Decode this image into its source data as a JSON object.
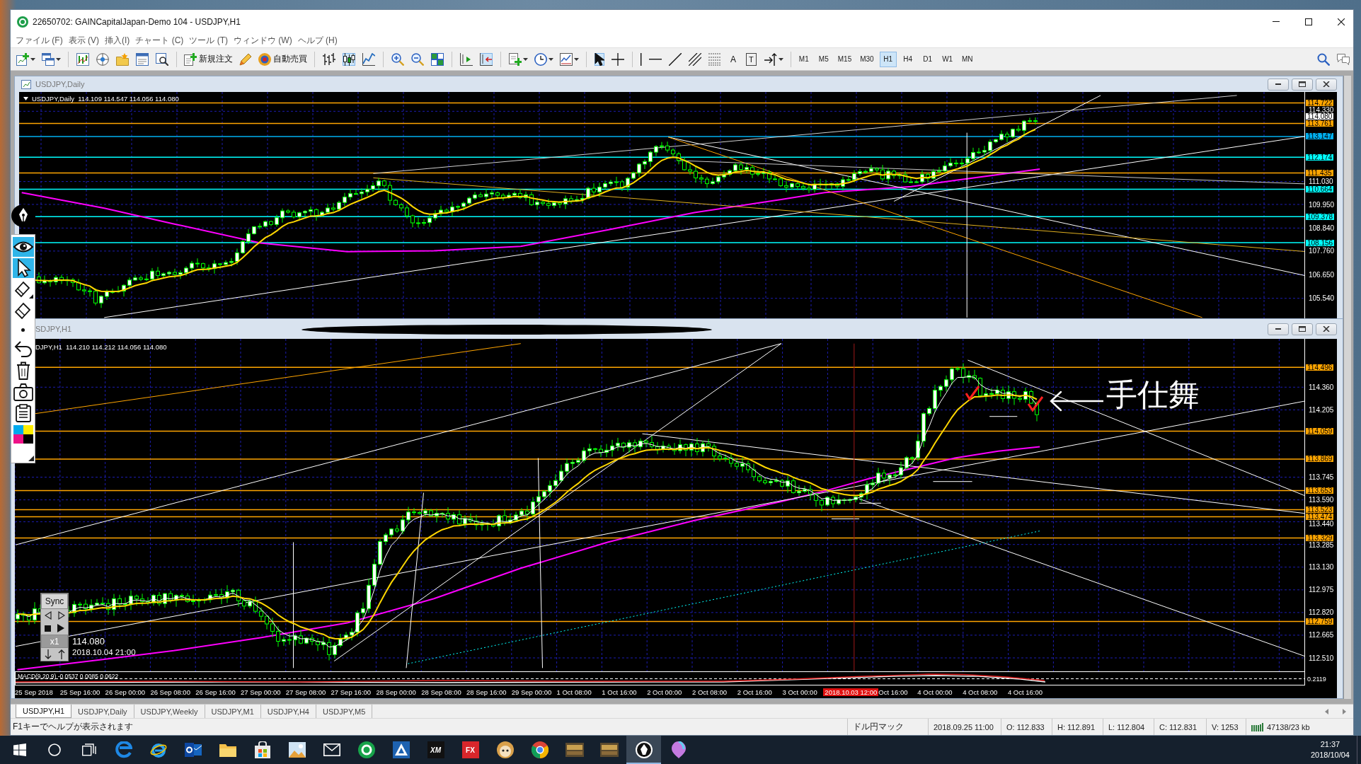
{
  "window": {
    "title": "22650702: GAINCapitalJapan-Demo 104 - USDJPY,H1"
  },
  "menu": [
    {
      "label": "ファイル (F)"
    },
    {
      "label": "表示 (V)"
    },
    {
      "label": "挿入(I)"
    },
    {
      "label": "チャート (C)"
    },
    {
      "label": "ツール (T)"
    },
    {
      "label": "ウィンドウ (W)"
    },
    {
      "label": "ヘルプ (H)"
    }
  ],
  "toolbar": {
    "order_buttons": [
      {
        "kind": "new_order",
        "label": "新規注文"
      },
      {
        "kind": "expert",
        "label": "自動売買"
      }
    ],
    "chart_types": [
      {
        "kind": "bars",
        "selected": false
      },
      {
        "kind": "candles",
        "selected": true
      },
      {
        "kind": "line",
        "selected": false
      }
    ],
    "toggles": [
      {
        "kind": "auto_scroll",
        "on": false
      },
      {
        "kind": "chart_shift",
        "on": true
      }
    ],
    "pointer_tools": [
      {
        "kind": "cursor",
        "selected": true
      },
      {
        "kind": "crosshair",
        "selected": false
      }
    ],
    "text_tools": [
      {
        "kind": "text",
        "label": "A"
      },
      {
        "kind": "label",
        "label": "T"
      }
    ],
    "timeframes": [
      {
        "label": "M1",
        "selected": false
      },
      {
        "label": "M5",
        "selected": false
      },
      {
        "label": "M15",
        "selected": false
      },
      {
        "label": "M30",
        "selected": false
      },
      {
        "label": "H1",
        "selected": true
      },
      {
        "label": "H4",
        "selected": false
      },
      {
        "label": "D1",
        "selected": false
      },
      {
        "label": "W1",
        "selected": false
      },
      {
        "label": "MN",
        "selected": false
      }
    ]
  },
  "drawing_palette": {
    "tools": [
      {
        "kind": "eye",
        "selected": true
      },
      {
        "kind": "cursor",
        "selected": true
      },
      {
        "kind": "marker",
        "selected": false
      },
      {
        "kind": "eraser",
        "selected": false
      },
      {
        "kind": "dot",
        "selected": false
      },
      {
        "kind": "undo",
        "selected": false
      },
      {
        "kind": "trash",
        "selected": false
      },
      {
        "kind": "camera",
        "selected": false
      },
      {
        "kind": "clipboard",
        "selected": false
      },
      {
        "kind": "colors",
        "selected": false
      }
    ]
  },
  "charts": [
    {
      "kind": "daily",
      "title": "USDJPY,Daily",
      "header": "USDJPY,Daily  114.109 114.547 114.056 114.080",
      "price_axis": [
        {
          "value": "114.722",
          "kind": "level",
          "color": "#ffa500"
        },
        {
          "value": "114.330",
          "kind": "tick"
        },
        {
          "value": "114.080",
          "kind": "bid"
        },
        {
          "value": "113.761",
          "kind": "level",
          "color": "#ffa500"
        },
        {
          "value": "113.147",
          "kind": "level",
          "color": "#00b0f0"
        },
        {
          "value": "112.174",
          "kind": "level",
          "color": "#00ffff"
        },
        {
          "value": "111.435",
          "kind": "level",
          "color": "#ffa500"
        },
        {
          "value": "111.030",
          "kind": "tick"
        },
        {
          "value": "110.664",
          "kind": "level",
          "color": "#00ffff"
        },
        {
          "value": "109.950",
          "kind": "tick"
        },
        {
          "value": "109.378",
          "kind": "level",
          "color": "#00ffff"
        },
        {
          "value": "108.840",
          "kind": "tick"
        },
        {
          "value": "108.156",
          "kind": "level",
          "color": "#00ffff"
        },
        {
          "value": "107.760",
          "kind": "tick"
        },
        {
          "value": "106.650",
          "kind": "tick"
        },
        {
          "value": "105.540",
          "kind": "tick"
        }
      ]
    },
    {
      "kind": "hourly",
      "title": "SDJPY,H1",
      "header": "DJPY,H1  114.210 114.212 114.056 114.080",
      "price_axis": [
        {
          "value": "114.496",
          "kind": "level",
          "color": "#ffa500"
        },
        {
          "value": "114.360",
          "kind": "tick"
        },
        {
          "value": "114.205",
          "kind": "tick"
        },
        {
          "value": "114.059",
          "kind": "level",
          "color": "#ffa500"
        },
        {
          "value": "113.869",
          "kind": "level",
          "color": "#ffa500"
        },
        {
          "value": "113.745",
          "kind": "tick"
        },
        {
          "value": "113.653",
          "kind": "level",
          "color": "#ffa500"
        },
        {
          "value": "113.590",
          "kind": "tick"
        },
        {
          "value": "113.523",
          "kind": "level",
          "color": "#ffa500"
        },
        {
          "value": "113.474",
          "kind": "level",
          "color": "#ffa500"
        },
        {
          "value": "113.440",
          "kind": "tick"
        },
        {
          "value": "113.329",
          "kind": "level",
          "color": "#ffa500"
        },
        {
          "value": "113.285",
          "kind": "tick"
        },
        {
          "value": "113.130",
          "kind": "tick"
        },
        {
          "value": "112.975",
          "kind": "tick"
        },
        {
          "value": "112.820",
          "kind": "tick"
        },
        {
          "value": "112.759",
          "kind": "level",
          "color": "#ffa500"
        },
        {
          "value": "112.665",
          "kind": "tick"
        },
        {
          "value": "112.510",
          "kind": "tick"
        }
      ],
      "time_axis": [
        {
          "label": "25 Sep 2018",
          "kind": "tick"
        },
        {
          "label": "25 Sep 16:00",
          "kind": "tick"
        },
        {
          "label": "26 Sep 00:00",
          "kind": "tick"
        },
        {
          "label": "26 Sep 08:00",
          "kind": "tick"
        },
        {
          "label": "26 Sep 16:00",
          "kind": "tick"
        },
        {
          "label": "27 Sep 00:00",
          "kind": "tick"
        },
        {
          "label": "27 Sep 08:00",
          "kind": "tick"
        },
        {
          "label": "27 Sep 16:00",
          "kind": "tick"
        },
        {
          "label": "28 Sep 00:00",
          "kind": "tick"
        },
        {
          "label": "28 Sep 08:00",
          "kind": "tick"
        },
        {
          "label": "28 Sep 16:00",
          "kind": "tick"
        },
        {
          "label": "29 Sep 00:00",
          "kind": "tick"
        },
        {
          "label": "1 Oct 08:00",
          "kind": "tick"
        },
        {
          "label": "1 Oct 16:00",
          "kind": "tick"
        },
        {
          "label": "2 Oct 00:00",
          "kind": "tick"
        },
        {
          "label": "2 Oct 08:00",
          "kind": "tick"
        },
        {
          "label": "2 Oct 16:00",
          "kind": "tick"
        },
        {
          "label": "3 Oct 00:00",
          "kind": "tick"
        },
        {
          "label": "2018.10.03 12:00",
          "kind": "cursor"
        },
        {
          "label": "Oct 16:00",
          "kind": "tick"
        },
        {
          "label": "4 Oct 00:00",
          "kind": "tick"
        },
        {
          "label": "4 Oct 08:00",
          "kind": "tick"
        },
        {
          "label": "4 Oct 16:00",
          "kind": "tick"
        }
      ],
      "macd": {
        "label": "MACD(9,20,9) -0.0537 0.0085 0.0622",
        "axis": [
          "0.2119"
        ]
      },
      "sync_panel": {
        "title": "Sync",
        "speed": "x1"
      },
      "cursor_readout": {
        "price": "114.080",
        "time": "2018.10.04 21:00"
      },
      "annotation": "手仕舞"
    }
  ],
  "chart_tabs": [
    {
      "label": "USDJPY,H1",
      "selected": true
    },
    {
      "label": "USDJPY,Daily",
      "selected": false
    },
    {
      "label": "USDJPY,Weekly",
      "selected": false
    },
    {
      "label": "USDJPY,M1",
      "selected": false
    },
    {
      "label": "USDJPY,H4",
      "selected": false
    },
    {
      "label": "USDJPY,M5",
      "selected": false
    }
  ],
  "status_bar": {
    "help": "F1キーでヘルプが表示されます",
    "profile": "ドル円マック",
    "time": "2018.09.25 11:00",
    "open": "O: 112.833",
    "high": "H: 112.891",
    "low": "L: 112.804",
    "close": "C: 112.831",
    "volume": "V: 1253",
    "traffic": "47138/23 kb"
  },
  "taskbar": {
    "apps": [
      {
        "kind": "edge",
        "active": false
      },
      {
        "kind": "ie",
        "active": false
      },
      {
        "kind": "outlook",
        "active": false
      },
      {
        "kind": "explorer",
        "active": false
      },
      {
        "kind": "store",
        "active": false
      },
      {
        "kind": "photos",
        "active": false
      },
      {
        "kind": "mail",
        "active": false
      },
      {
        "kind": "green_app",
        "active": false
      },
      {
        "kind": "triangle_app",
        "active": false
      },
      {
        "kind": "tile",
        "label": "XM",
        "active": false
      },
      {
        "kind": "tile",
        "label": "FX",
        "active": false
      },
      {
        "kind": "round_app",
        "active": false
      },
      {
        "kind": "chrome",
        "active": false
      },
      {
        "kind": "thumbnail",
        "active": false
      },
      {
        "kind": "thumbnail",
        "active": false
      },
      {
        "kind": "metatrader",
        "active": true
      },
      {
        "kind": "balloon",
        "active": false
      }
    ],
    "time": "21:37",
    "date": "2018/10/04"
  }
}
